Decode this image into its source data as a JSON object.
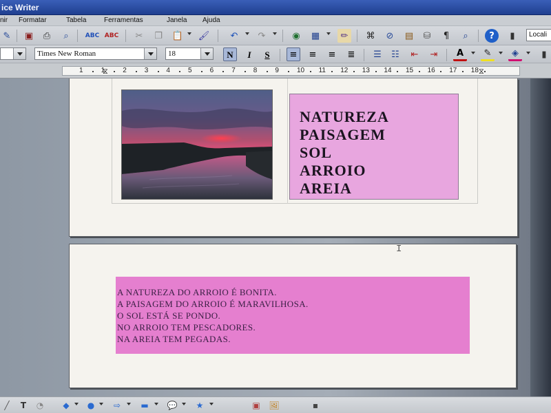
{
  "window": {
    "title": "ice Writer"
  },
  "menu": {
    "items": [
      "nir",
      "Formatar",
      "Tabela",
      "Ferramentas",
      "Janela",
      "Ajuda"
    ]
  },
  "toolbar": {
    "search_placeholder": "Locali"
  },
  "format_bar": {
    "font_name": "Times New Roman",
    "font_size": "18",
    "bold_label": "N",
    "italic_label": "I",
    "underline_label": "S"
  },
  "ruler": {
    "labels": [
      "1",
      "1",
      "2",
      "3",
      "4",
      "5",
      "6",
      "7",
      "8",
      "9",
      "10",
      "11",
      "12",
      "13",
      "14",
      "15",
      "16",
      "17",
      "18"
    ]
  },
  "document": {
    "page1": {
      "words": [
        "NATUREZA",
        "PAISAGEM",
        "SOL",
        "ARROIO",
        "AREIA"
      ],
      "box_color": "#e8a6df"
    },
    "page2": {
      "lines": [
        "A NATUREZA DO ARROIO É BONITA.",
        "A PAISAGEM  DO ARROIO É MARAVILHOSA.",
        "O SOL ESTÁ SE PONDO.",
        "NO ARROIO TEM PESCADORES.",
        "NA AREIA TEM PEGADAS."
      ],
      "box_color": "#e57fcf"
    }
  }
}
